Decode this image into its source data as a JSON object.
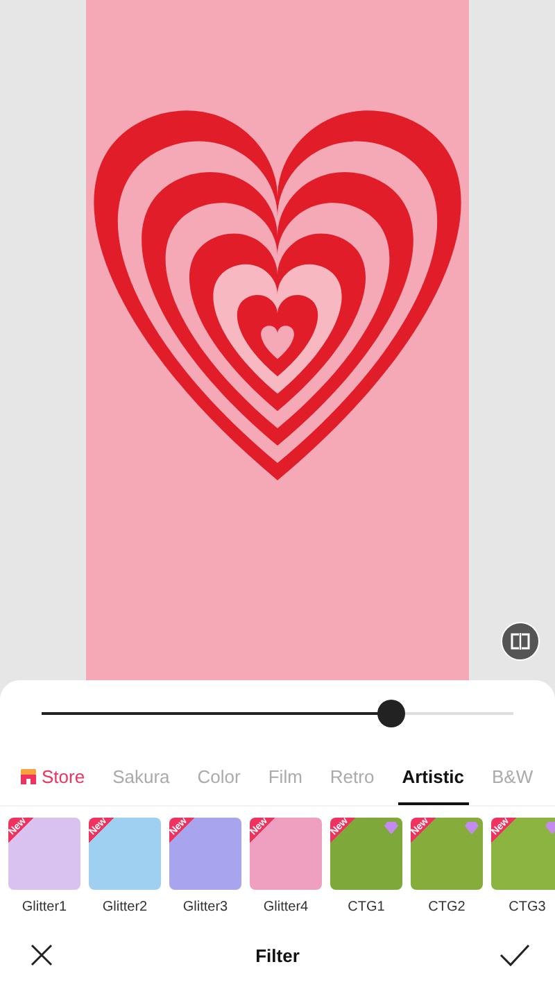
{
  "slider": {
    "level": 0.74
  },
  "tabs": [
    {
      "label": "Store",
      "kind": "store",
      "selected": false
    },
    {
      "label": "Sakura",
      "kind": "category",
      "selected": false
    },
    {
      "label": "Color",
      "kind": "category",
      "selected": false
    },
    {
      "label": "Film",
      "kind": "category",
      "selected": false
    },
    {
      "label": "Retro",
      "kind": "category",
      "selected": false
    },
    {
      "label": "Artistic",
      "kind": "category",
      "selected": true
    },
    {
      "label": "B&W",
      "kind": "category",
      "selected": false
    }
  ],
  "filters": [
    {
      "name": "Glitter1",
      "badge": "New",
      "premium": false,
      "color": "#d9c2f0"
    },
    {
      "name": "Glitter2",
      "badge": "New",
      "premium": false,
      "color": "#9fd0f2"
    },
    {
      "name": "Glitter3",
      "badge": "New",
      "premium": false,
      "color": "#a9a4ee"
    },
    {
      "name": "Glitter4",
      "badge": "New",
      "premium": false,
      "color": "#ef9fbf"
    },
    {
      "name": "CTG1",
      "badge": "New",
      "premium": true,
      "color": "#7fa83a"
    },
    {
      "name": "CTG2",
      "badge": "New",
      "premium": true,
      "color": "#86ad3c"
    },
    {
      "name": "CTG3",
      "badge": "New",
      "premium": true,
      "color": "#8bb440"
    }
  ],
  "bottom_bar": {
    "title": "Filter"
  }
}
